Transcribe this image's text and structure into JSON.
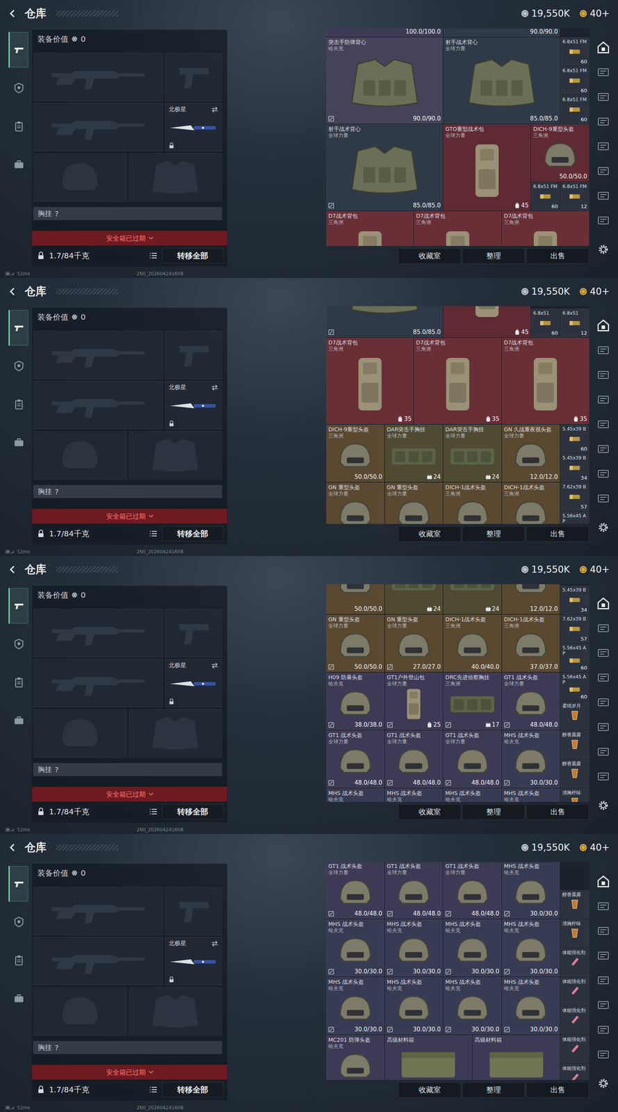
{
  "screen": {
    "title": "仓库",
    "currencies": [
      {
        "kind": "silver",
        "value": "19,550K"
      },
      {
        "kind": "gold",
        "value": "40+"
      }
    ],
    "leftTabs": [
      {
        "kind": "gun",
        "selected": true
      },
      {
        "kind": "badge",
        "selected": false
      },
      {
        "kind": "clipboard",
        "selected": false
      },
      {
        "kind": "case",
        "selected": false
      }
    ],
    "loadout": {
      "valueLabel": "装备价值",
      "value": "0",
      "slots": [
        {
          "kind": "rifle",
          "filled": false
        },
        {
          "kind": "pistol",
          "filled": false
        },
        {
          "kind": "rifle",
          "filled": false
        },
        {
          "kind": "knife",
          "filled": true,
          "name": "北极星",
          "locked": true,
          "swap": true
        },
        {
          "kind": "helmet",
          "filled": false
        },
        {
          "kind": "armor",
          "filled": false
        }
      ],
      "rig": {
        "label": "胸挂",
        "hint": "?"
      },
      "safebox": {
        "label": "安全箱已过期",
        "expired": true
      },
      "weight": "1.7/84千克",
      "transfer": "转移全部"
    },
    "gridButtons": [
      "收藏室",
      "整理",
      "出售"
    ],
    "rightTabs": [
      {
        "selected": true
      },
      {
        "selected": false
      },
      {
        "selected": false
      },
      {
        "selected": false
      },
      {
        "selected": false
      },
      {
        "selected": false
      },
      {
        "selected": false
      },
      {
        "selected": false
      }
    ],
    "status": {
      "ping": "52ms",
      "build": "260_202604241608"
    }
  },
  "views": [
    {
      "peek": [
        {
          "kind": "vest",
          "reading": "100.0/100.0",
          "color": "#3d3a56",
          "flag": false
        },
        {
          "kind": "vest",
          "reading": "90.0/90.0",
          "color": "#2f3a48",
          "flag": false
        }
      ],
      "items": [
        {
          "kind": "vest",
          "name": "突击手防弹背心",
          "sub": "哈夫克",
          "reading": "90.0/90.0",
          "color": "#45435a",
          "flag": true
        },
        {
          "kind": "vest",
          "name": "射手战术背心",
          "sub": "全球力量",
          "reading": "85.0/85.0",
          "color": "#2f3a48",
          "flag": false
        },
        {
          "kind": "ammo",
          "name": "6.8x51 FM",
          "count": "60",
          "color": "#2c333e",
          "flag": false
        },
        {
          "kind": "ammo",
          "name": "6.8x51 FM",
          "count": "60",
          "color": "#2c333e",
          "flag": false
        },
        {
          "kind": "ammo",
          "name": "6.8x51 FM",
          "count": "60",
          "color": "#2c333e",
          "flag": false
        },
        {
          "kind": "vest",
          "name": "射手战术背心",
          "sub": "全球力量",
          "reading": "85.0/85.0",
          "color": "#2f3a48",
          "flag": true
        },
        {
          "kind": "bag-l",
          "name": "GTO重型战术包",
          "sub": "全球力量",
          "count": "45",
          "color": "#5f2a33",
          "flag": false
        },
        {
          "kind": "helmet",
          "name": "DICH-9重型头盔",
          "sub": "三角洲",
          "reading": "50.0/50.0",
          "color": "#5f2a33",
          "flag": false
        },
        {
          "kind": "ammo",
          "name": "6.8x51 FM",
          "count": "60",
          "color": "#2c333e",
          "flag": false
        },
        {
          "kind": "ammo",
          "name": "6.8x51 FM",
          "count": "12",
          "color": "#2c333e",
          "flag": false
        },
        {
          "kind": "bag-l",
          "name": "D7战术背包",
          "sub": "三角洲",
          "color": "#6a2e36",
          "flag": false
        },
        {
          "kind": "bag-l",
          "name": "D7战术背包",
          "sub": "三角洲",
          "color": "#6a2e36",
          "flag": false
        },
        {
          "kind": "bag-l",
          "name": "D7战术背包",
          "sub": "三角洲",
          "color": "#6a2e36",
          "flag": false
        }
      ]
    },
    {
      "peek": [
        {
          "kind": "vest",
          "reading": "85.0/85.0",
          "color": "#2f3a48",
          "flag": true
        },
        {
          "kind": "bag-l",
          "count": "45",
          "color": "#5f2a33",
          "flag": false
        },
        {
          "kind": "ammo",
          "name": "6.8x51",
          "count": "60",
          "color": "#2c333e",
          "flag": false
        },
        {
          "kind": "ammo",
          "name": "6.8x51",
          "count": "12",
          "color": "#2c333e",
          "flag": false
        }
      ],
      "items": [
        {
          "kind": "bag-l",
          "name": "D7战术背包",
          "sub": "三角洲",
          "count": "35",
          "color": "#6a2e36",
          "flag": false
        },
        {
          "kind": "bag-l",
          "name": "D7战术背包",
          "sub": "三角洲",
          "count": "35",
          "color": "#6a2e36",
          "flag": false
        },
        {
          "kind": "bag-l",
          "name": "D7战术背包",
          "sub": "三角洲",
          "count": "35",
          "color": "#6a2e36",
          "flag": false
        },
        {
          "kind": "helmet",
          "name": "DICH-9重型头盔",
          "sub": "三角洲",
          "reading": "50.0/50.0",
          "color": "#5a4830",
          "flag": false
        },
        {
          "kind": "rig",
          "name": "DAR突击手胸挂",
          "sub": "全球力量",
          "count": "24",
          "color": "#4f4a32",
          "flag": false
        },
        {
          "kind": "rig",
          "name": "DAR突击手胸挂",
          "sub": "全球力量",
          "count": "24",
          "color": "#4f4a32",
          "flag": false
        },
        {
          "kind": "helmet",
          "name": "GN 久战重夜视头盔",
          "sub": "全球力量",
          "reading": "12.0/12.0",
          "color": "#5a4830",
          "flag": false
        },
        {
          "kind": "ammo",
          "name": "5.45x39 B",
          "count": "60",
          "color": "#2c333e",
          "flag": false
        },
        {
          "kind": "ammo",
          "name": "5.45x39 B",
          "count": "34",
          "color": "#2c333e",
          "flag": false
        },
        {
          "kind": "helmet",
          "name": "GN 重型头盔",
          "sub": "全球力量",
          "color": "#5a4830",
          "flag": false
        },
        {
          "kind": "helmet",
          "name": "GN 重型头盔",
          "sub": "全球力量",
          "color": "#5a4830",
          "flag": false
        },
        {
          "kind": "helmet",
          "name": "DICH-1战术头盔",
          "sub": "三角洲",
          "color": "#5a4830",
          "flag": false
        },
        {
          "kind": "helmet",
          "name": "DICH-1战术头盔",
          "sub": "三角洲",
          "color": "#5a4830",
          "flag": false
        },
        {
          "kind": "ammo",
          "name": "7.62x39 B",
          "count": "57",
          "color": "#2c333e",
          "flag": false
        },
        {
          "kind": "ammo",
          "name": "5.56x45 AP",
          "color": "#2c333e",
          "flag": false
        }
      ]
    },
    {
      "peek": [
        {
          "kind": "helmet",
          "reading": "50.0/50.0",
          "color": "#5a4830",
          "flag": false
        },
        {
          "kind": "rig",
          "count": "24",
          "color": "#4f4a32",
          "flag": false
        },
        {
          "kind": "rig",
          "count": "24",
          "color": "#4f4a32",
          "flag": false
        },
        {
          "kind": "helmet",
          "reading": "12.0/12.0",
          "color": "#5a4830",
          "flag": false
        },
        {
          "kind": "ammo",
          "name": "5.45x39 B",
          "count": "34",
          "color": "#2c333e",
          "flag": false
        }
      ],
      "items": [
        {
          "kind": "helmet",
          "name": "GN 重型头盔",
          "sub": "全球力量",
          "reading": "50.0/50.0",
          "color": "#5a4830",
          "flag": true
        },
        {
          "kind": "helmet",
          "name": "GN 重型头盔",
          "sub": "全球力量",
          "reading": "27.0/27.0",
          "color": "#5a4830",
          "flag": true
        },
        {
          "kind": "helmet",
          "name": "DICH-1战术头盔",
          "sub": "三角洲",
          "reading": "40.0/40.0",
          "color": "#5a4830",
          "flag": false
        },
        {
          "kind": "helmet",
          "name": "DICH-1战术头盔",
          "sub": "三角洲",
          "reading": "37.0/37.0",
          "color": "#5a4830",
          "flag": false
        },
        {
          "kind": "ammo",
          "name": "7.62x39 B",
          "count": "57",
          "color": "#2c333e",
          "flag": false
        },
        {
          "kind": "ammo",
          "name": "5.56x45 AP",
          "count": "60",
          "color": "#2c333e",
          "flag": false
        },
        {
          "kind": "helmet",
          "name": "H09 防暴头盔",
          "sub": "哈夫克",
          "reading": "38.0/38.0",
          "color": "#3d3a56",
          "flag": true
        },
        {
          "kind": "bag-s",
          "name": "GT1户外登山包",
          "sub": "全球力量",
          "count": "25",
          "color": "#3d3a56",
          "flag": true
        },
        {
          "kind": "rig",
          "name": "DRC先进侦察胸挂",
          "sub": "三角洲",
          "count": "17",
          "color": "#3d3a56",
          "flag": true
        },
        {
          "kind": "helmet",
          "name": "GT1 战术头盔",
          "sub": "全球力量",
          "reading": "48.0/48.0",
          "color": "#3d3a56",
          "flag": true
        },
        {
          "kind": "ammo",
          "name": "5.56x45 AP",
          "count": "60",
          "color": "#2c333e",
          "flag": false
        },
        {
          "kind": "drink",
          "name": "柔情岁月",
          "color": "#2c333e",
          "flag": false
        },
        {
          "kind": "helmet",
          "name": "GT1 战术头盔",
          "sub": "全球力量",
          "reading": "48.0/48.0",
          "color": "#3d3a56",
          "flag": true
        },
        {
          "kind": "helmet",
          "name": "GT1 战术头盔",
          "sub": "全球力量",
          "reading": "48.0/48.0",
          "color": "#3d3a56",
          "flag": true
        },
        {
          "kind": "helmet",
          "name": "GT1 战术头盔",
          "sub": "全球力量",
          "reading": "48.0/48.0",
          "color": "#3d3a56",
          "flag": true
        },
        {
          "kind": "helmet",
          "name": "MHS 战术头盔",
          "sub": "哈夫克",
          "reading": "30.0/30.0",
          "color": "#383b54",
          "flag": true
        },
        {
          "kind": "drink",
          "name": "醇香晨露",
          "color": "#2c333e",
          "flag": false
        },
        {
          "kind": "drink",
          "name": "醇香晨露",
          "color": "#2c333e",
          "flag": false
        },
        {
          "kind": "helmet",
          "name": "MHS 战术头盔",
          "sub": "哈夫克",
          "color": "#383b54",
          "flag": false
        },
        {
          "kind": "helmet",
          "name": "MHS 战术头盔",
          "sub": "哈夫克",
          "color": "#383b54",
          "flag": false
        },
        {
          "kind": "helmet",
          "name": "MHS 战术头盔",
          "sub": "哈夫克",
          "color": "#383b54",
          "flag": false
        },
        {
          "kind": "helmet",
          "name": "MHS 战术头盔",
          "sub": "哈夫克",
          "color": "#383b54",
          "flag": false
        },
        {
          "kind": "drink",
          "name": "清腌柠味",
          "color": "#2c333e",
          "flag": false
        }
      ]
    },
    {
      "peek": [
        {
          "kind": "helmet",
          "name": "GT1 战术头盔",
          "sub": "全球力量",
          "reading": "48.0/48.0",
          "color": "#3d3a56",
          "flag": true
        },
        {
          "kind": "helmet",
          "name": "GT1 战术头盔",
          "sub": "全球力量",
          "reading": "48.0/48.0",
          "color": "#3d3a56",
          "flag": true
        },
        {
          "kind": "helmet",
          "name": "GT1 战术头盔",
          "sub": "全球力量",
          "reading": "48.0/48.0",
          "color": "#3d3a56",
          "flag": true
        },
        {
          "kind": "helmet",
          "name": "MHS 战术头盔",
          "sub": "哈夫克",
          "reading": "30.0/30.0",
          "color": "#383b54",
          "flag": true
        },
        {
          "kind": "drink",
          "name": "醇香晨露",
          "color": "#2c333e",
          "flag": false
        }
      ],
      "items": [
        {
          "kind": "helmet",
          "name": "MHS 战术头盔",
          "sub": "哈夫克",
          "reading": "30.0/30.0",
          "color": "#383b54",
          "flag": true
        },
        {
          "kind": "helmet",
          "name": "MHS 战术头盔",
          "sub": "哈夫克",
          "reading": "30.0/30.0",
          "color": "#383b54",
          "flag": true
        },
        {
          "kind": "helmet",
          "name": "MHS 战术头盔",
          "sub": "哈夫克",
          "reading": "30.0/30.0",
          "color": "#383b54",
          "flag": true
        },
        {
          "kind": "helmet",
          "name": "MHS 战术头盔",
          "sub": "哈夫克",
          "reading": "30.0/30.0",
          "color": "#383b54",
          "flag": true
        },
        {
          "kind": "drink",
          "name": "清腌柠味",
          "color": "#2c333e",
          "flag": false
        },
        {
          "kind": "syringe",
          "name": "体能强化剂",
          "color": "#2c333e",
          "flag": false
        },
        {
          "kind": "helmet",
          "name": "MHS 战术头盔",
          "sub": "哈夫克",
          "reading": "30.0/30.0",
          "color": "#383b54",
          "flag": true
        },
        {
          "kind": "helmet",
          "name": "MHS 战术头盔",
          "sub": "哈夫克",
          "reading": "30.0/30.0",
          "color": "#383b54",
          "flag": true
        },
        {
          "kind": "helmet",
          "name": "MHS 战术头盔",
          "sub": "哈夫克",
          "reading": "30.0/30.0",
          "color": "#383b54",
          "flag": true
        },
        {
          "kind": "helmet",
          "name": "MHS 战术头盔",
          "sub": "哈夫克",
          "reading": "30.0/30.0",
          "color": "#383b54",
          "flag": true
        },
        {
          "kind": "syringe",
          "name": "体能强化剂",
          "color": "#2c333e",
          "flag": false
        },
        {
          "kind": "syringe",
          "name": "体能强化剂",
          "color": "#2c333e",
          "flag": false
        },
        {
          "kind": "helmet",
          "name": "MC201 防弹头盔",
          "sub": "哈夫克",
          "color": "#3d3a56",
          "flag": false
        },
        {
          "kind": "box",
          "name": "高级材料箱",
          "color": "#3d3a56",
          "flag": false
        },
        {
          "kind": "box",
          "name": "高级材料箱",
          "color": "#3d3a56",
          "flag": false
        },
        {
          "kind": "syringe",
          "name": "体能强化剂",
          "color": "#2c333e",
          "flag": false
        },
        {
          "kind": "syringe",
          "name": "体能强化剂",
          "color": "#2c333e",
          "flag": false
        }
      ]
    }
  ]
}
